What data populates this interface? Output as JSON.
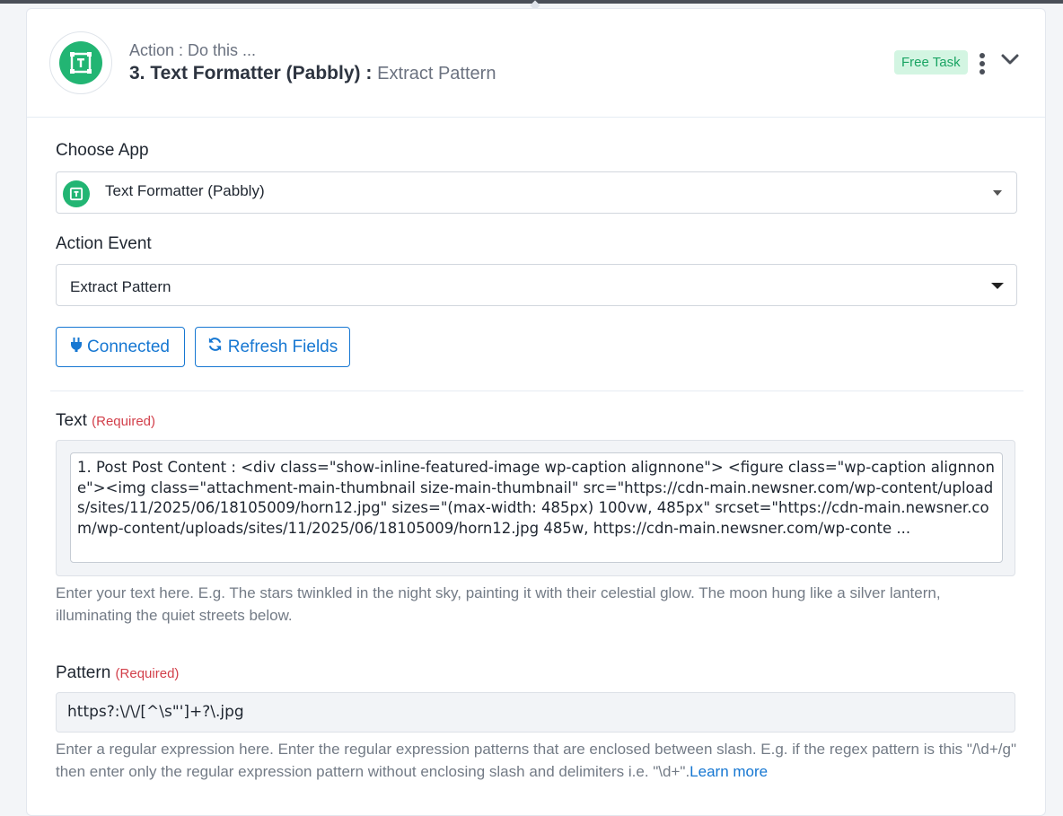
{
  "header": {
    "action_sub": "Action : Do this ...",
    "title_main": "3. Text Formatter (Pabbly) :",
    "title_event": "Extract Pattern",
    "badge": "Free Task",
    "app_icon": "text-formatter-icon",
    "menu_icon": "more-vertical-icon",
    "collapse_icon": "chevron-down-icon"
  },
  "choose_app": {
    "label": "Choose App",
    "value": "Text Formatter (Pabbly)",
    "icon": "text-formatter-icon"
  },
  "action_event": {
    "label": "Action Event",
    "value": "Extract Pattern"
  },
  "buttons": {
    "connected": "Connected",
    "refresh": "Refresh Fields"
  },
  "text_field": {
    "label": "Text",
    "required": "(Required)",
    "value": "1. Post Post Content : <div class=\"show-inline-featured-image wp-caption alignnone\"> <figure class=\"wp-caption alignnone\"><img class=\"attachment-main-thumbnail size-main-thumbnail\" src=\"https://cdn-main.newsner.com/wp-content/uploads/sites/11/2025/06/18105009/horn12.jpg\" sizes=\"(max-width: 485px) 100vw, 485px\" srcset=\"https://cdn-main.newsner.com/wp-content/uploads/sites/11/2025/06/18105009/horn12.jpg 485w, https://cdn-main.newsner.com/wp-conte ...",
    "help": "Enter your text here. E.g. The stars twinkled in the night sky, painting it with their celestial glow. The moon hung like a silver lantern, illuminating the quiet streets below."
  },
  "pattern_field": {
    "label": "Pattern",
    "required": "(Required)",
    "value": "https?:\\/\\/[^\\s\"']+?\\.jpg",
    "help": "Enter a regular expression here. Enter the regular expression patterns that are enclosed between slash. E.g. if the regex pattern is this \"/\\d+/g\" then enter only the regular expression pattern without enclosing slash and delimiters i.e. \"\\d+\".",
    "learn_more": "Learn more"
  },
  "colors": {
    "accent": "#1677d2",
    "brand_green": "#22b573",
    "required_red": "#d23f4a"
  }
}
